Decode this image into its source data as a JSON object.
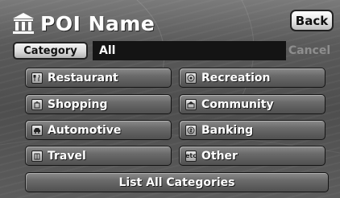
{
  "header": {
    "title": "POI Name",
    "back_label": "Back"
  },
  "search": {
    "category_label": "Category",
    "category_value": "All",
    "cancel_label": "Cancel"
  },
  "categories": [
    {
      "label": "Restaurant",
      "icon": "restaurant-icon"
    },
    {
      "label": "Recreation",
      "icon": "recreation-icon"
    },
    {
      "label": "Shopping",
      "icon": "shopping-icon"
    },
    {
      "label": "Community",
      "icon": "community-icon"
    },
    {
      "label": "Automotive",
      "icon": "automotive-icon"
    },
    {
      "label": "Banking",
      "icon": "banking-icon"
    },
    {
      "label": "Travel",
      "icon": "travel-icon"
    },
    {
      "label": "Other",
      "icon": "other-icon",
      "icon_text": "etc"
    }
  ],
  "footer": {
    "list_all_label": "List All Categories"
  },
  "colors": {
    "background": "#5a5a5a",
    "field": "#141414",
    "text": "#ffffff",
    "disabled": "#8e8e8e"
  }
}
